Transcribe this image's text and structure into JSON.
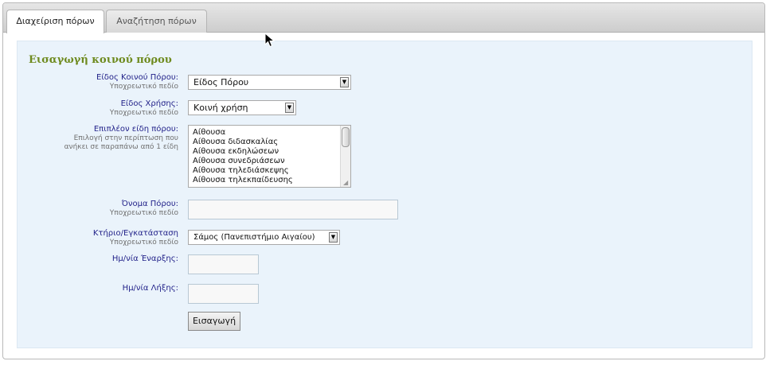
{
  "tabs": [
    {
      "label": "Διαχείριση πόρων",
      "active": true
    },
    {
      "label": "Αναζήτηση πόρων",
      "active": false
    }
  ],
  "form": {
    "legend": "Εισαγωγή κοινού πόρου",
    "required_hint": "Υποχρεωτικό πεδίο",
    "resource_type": {
      "label": "Είδος Κοινού Πόρου:",
      "value": "Είδος Πόρου"
    },
    "usage_type": {
      "label": "Είδος Χρήσης:",
      "value": "Κοινή χρήση"
    },
    "extra_types": {
      "label": "Επιπλέον είδη πόρου:",
      "hint_line1": "Επιλογή στην περίπτωση που",
      "hint_line2": "ανήκει σε παραπάνω από 1 είδη",
      "options": [
        "Αίθουσα",
        "Αίθουσα διδασκαλίας",
        "Αίθουσα εκδηλώσεων",
        "Αίθουσα συνεδριάσεων",
        "Αίθουσα τηλεδιάσκεψης",
        "Αίθουσα τηλεκπαίδευσης"
      ]
    },
    "resource_name": {
      "label": "Όνομα Πόρου:",
      "value": ""
    },
    "building": {
      "label": "Κτήριο/Εγκατάσταση",
      "value": "Σάμος (Πανεπιστήμιο Αιγαίου)"
    },
    "start_date": {
      "label": "Ημ/νία Έναρξης:",
      "value": ""
    },
    "end_date": {
      "label": "Ημ/νία Λήξης:",
      "value": ""
    },
    "submit_label": "Εισαγωγή"
  },
  "colors": {
    "legend": "#6e8a1e",
    "label": "#23238a",
    "panel_bg": "#eaf3fb"
  },
  "icons": {
    "dropdown": "chevron-down-icon",
    "cursor": "mouse-pointer-icon"
  }
}
